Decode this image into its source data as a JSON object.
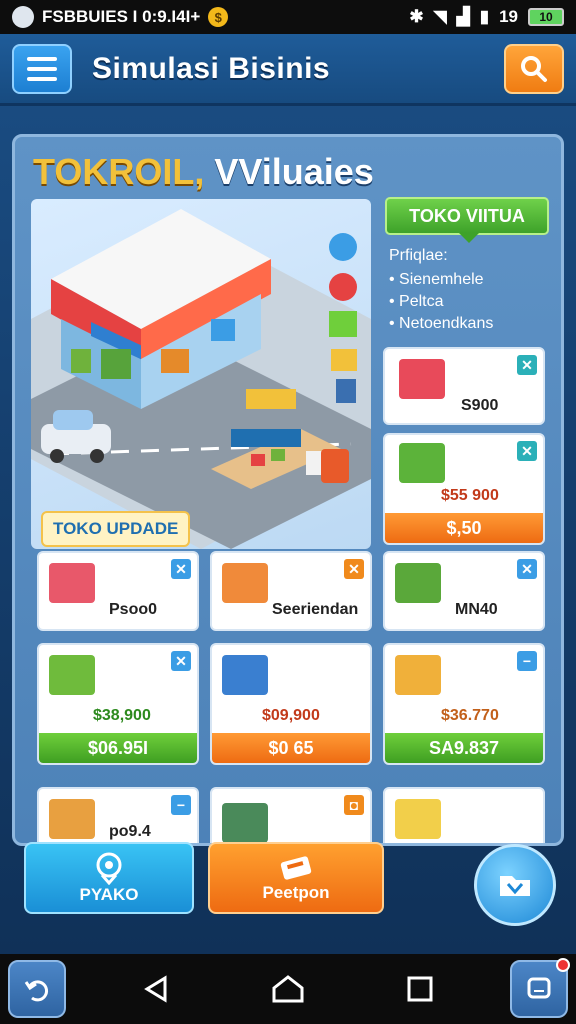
{
  "status": {
    "left_text": "FSBBUIES I 0:9.I4I+",
    "time": "19",
    "battery": "10"
  },
  "header": {
    "title": "Simulasi Bisinis"
  },
  "panel": {
    "title_a": "TOKROIL,",
    "title_b": " VViluaies",
    "upgrade_tag": "TOKO UPDADE",
    "info": {
      "tag": "TOKO VIITUA",
      "heading": "Prfiqlae:",
      "items": [
        "Sienemhele",
        "Peltca",
        "Netoendkans"
      ]
    }
  },
  "cards": {
    "c1": {
      "price": "S900"
    },
    "c2": {
      "price": "$55 900",
      "bar": "$,50"
    },
    "c3": {
      "label": "Psoo0"
    },
    "c4": {
      "label": "Seeriendan"
    },
    "c5": {
      "label": "MN40"
    },
    "c6": {
      "price": "$38,900",
      "bar": "$06.95I"
    },
    "c7": {
      "price": "$09,900",
      "bar": "$0 65"
    },
    "c8": {
      "price": "$36.770",
      "bar": "SA9.837"
    },
    "c9": {
      "label": "po9.4"
    }
  },
  "bottom": {
    "left_label": "PYAKO",
    "middle_label": "Peetpon"
  },
  "colors": {
    "accent_green": "#3f9f22",
    "accent_orange": "#ee6b12",
    "accent_blue": "#1a8fd6",
    "title_gold": "#f2c13a"
  },
  "icons": [
    "menu-icon",
    "search-icon",
    "pin-icon",
    "folder-icon",
    "ticket-icon",
    "back-icon",
    "home-icon",
    "recents-icon",
    "chat-icon"
  ]
}
